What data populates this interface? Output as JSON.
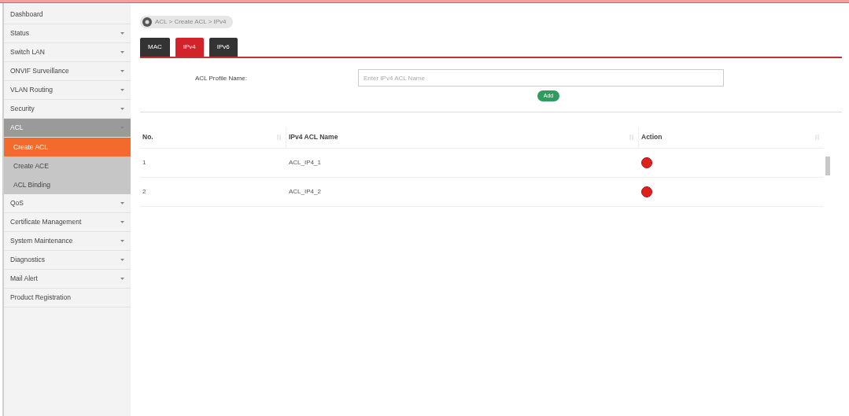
{
  "sidebar": {
    "items": [
      {
        "label": "Dashboard",
        "expandable": false,
        "selected": false
      },
      {
        "label": "Status",
        "expandable": true,
        "selected": false
      },
      {
        "label": "Switch LAN",
        "expandable": true,
        "selected": false
      },
      {
        "label": "ONVIF Surveillance",
        "expandable": true,
        "selected": false
      },
      {
        "label": "VLAN Routing",
        "expandable": true,
        "selected": false
      },
      {
        "label": "Security",
        "expandable": true,
        "selected": false
      },
      {
        "label": "ACL",
        "expandable": true,
        "selected": true,
        "children": [
          {
            "label": "Create ACL",
            "selected": true
          },
          {
            "label": "Create ACE",
            "selected": false
          },
          {
            "label": "ACL Binding",
            "selected": false
          }
        ]
      },
      {
        "label": "QoS",
        "expandable": true,
        "selected": false
      },
      {
        "label": "Certificate Management",
        "expandable": true,
        "selected": false
      },
      {
        "label": "System Maintenance",
        "expandable": true,
        "selected": false
      },
      {
        "label": "Diagnostics",
        "expandable": true,
        "selected": false
      },
      {
        "label": "Mail Alert",
        "expandable": true,
        "selected": false
      },
      {
        "label": "Product Registration",
        "expandable": false,
        "selected": false
      }
    ]
  },
  "breadcrumb": "ACL > Create ACL > IPv4",
  "tabs": [
    {
      "label": "MAC",
      "selected": false
    },
    {
      "label": "IPv4",
      "selected": true
    },
    {
      "label": "IPv6",
      "selected": false
    }
  ],
  "form": {
    "label": "ACL Profile Name:",
    "placeholder": "Enter IPv4 ACL Name",
    "button": "Add"
  },
  "table": {
    "columns": [
      "No.",
      "IPv4 ACL Name",
      "Action"
    ],
    "rows": [
      {
        "no": "1",
        "name": "ACL_IP4_1"
      },
      {
        "no": "2",
        "name": "ACL_IP4_2"
      }
    ]
  }
}
